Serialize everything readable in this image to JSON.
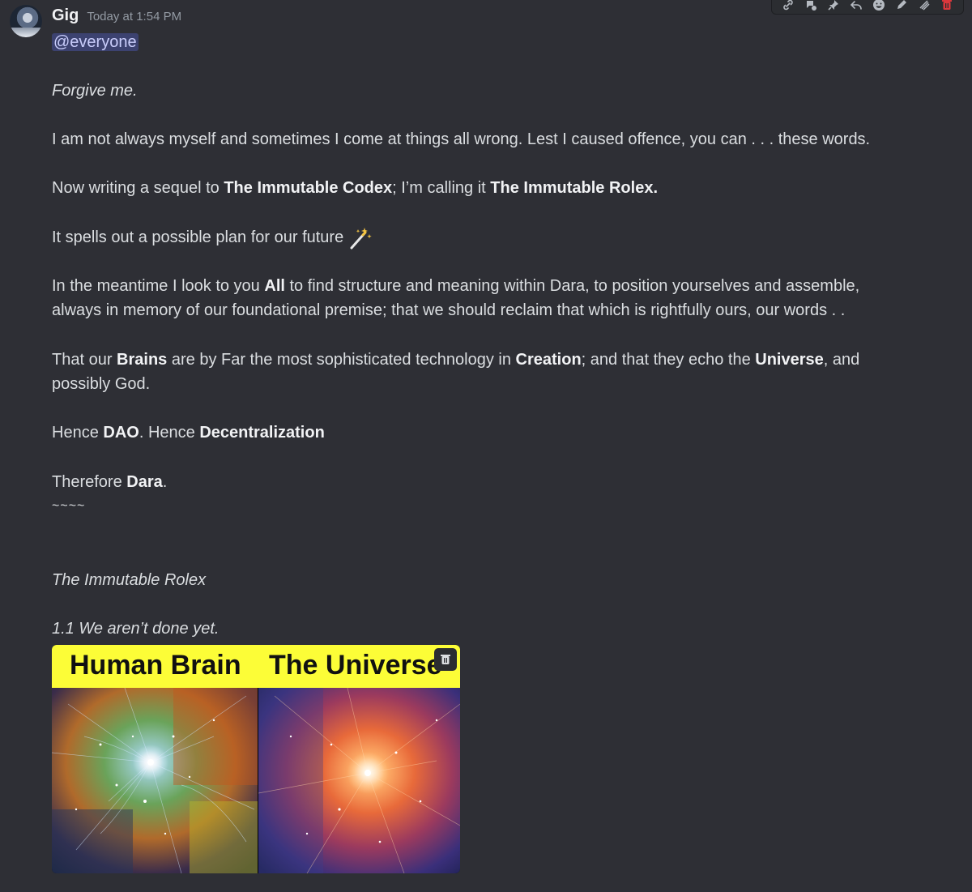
{
  "message": {
    "username": "Gig",
    "timestamp": "Today at 1:54 PM",
    "mention": "@everyone",
    "lines": {
      "l1": "Forgive me.",
      "l2": "I am not always myself and sometimes I come at things all wrong. Lest I caused offence, you can . . . these words.",
      "l3a": "Now writing a sequel to ",
      "l3b": "The Immutable Codex",
      "l3c": "; I’m calling it ",
      "l3d": "The Immutable Rolex.",
      "l4": "It spells out a possible plan for our future",
      "l5a": "In the meantime I look to you ",
      "l5b": "All",
      "l5c": " to find structure and meaning within Dara, to position yourselves and assemble,",
      "l6": "always in memory of our foundational premise; that we should reclaim that which is rightfully ours, our words . .",
      "l7a": "That our ",
      "l7b": "Brains",
      "l7c": " are by Far the most sophisticated technology in ",
      "l7d": "Creation",
      "l7e": "; and that they echo the ",
      "l7f": "Universe",
      "l7g": ", and",
      "l8": "possibly God.",
      "l9a": "Hence ",
      "l9b": "DAO",
      "l9c": ". Hence ",
      "l9d": "Decentralization",
      "l10a": "Therefore ",
      "l10b": "Dara",
      "l10c": ".",
      "l11": "~~~~",
      "l12": "The Immutable Rolex",
      "l13": "1.1 We aren’t done yet."
    },
    "emoji": "magic-wand-icon"
  },
  "embed": {
    "left_title": "Human Brain",
    "right_title": "The Universe"
  },
  "toolbar": {
    "icons": [
      "link-icon",
      "thread-icon",
      "pin-icon",
      "reply-icon",
      "emoji-icon",
      "edit-icon",
      "more-icon",
      "delete-icon"
    ]
  },
  "colors": {
    "background": "#2e2f35",
    "mention_bg": "#3c4270",
    "mention_text": "#c9cdfb",
    "embed_header": "#fcfd37",
    "delete": "#da373c"
  }
}
